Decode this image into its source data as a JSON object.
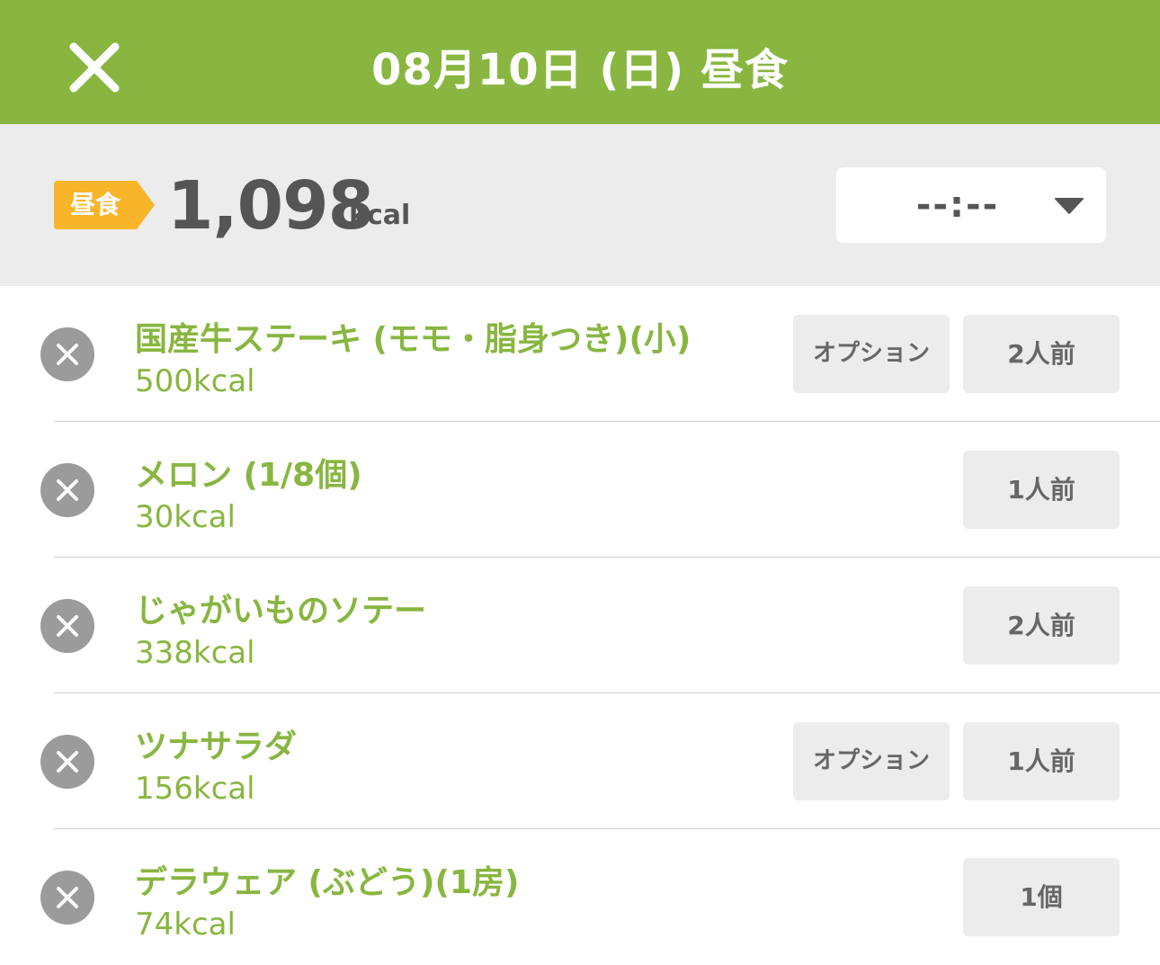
{
  "header": {
    "title": "08月10日 (日) 昼食",
    "close_icon": "close-icon"
  },
  "summary": {
    "meal_label": "昼食",
    "total_kcal": "1,098",
    "kcal_unit": "kcal",
    "time_value": "--:--",
    "time_icon": "chevron-down-icon"
  },
  "colors": {
    "accent": "#88b640",
    "badge": "#f8b52a",
    "summary_bg": "#ececec",
    "remove_icon_bg": "#9b9b9b"
  },
  "food_items": [
    {
      "name": "国産牛ステーキ (モモ・脂身つき)(小)",
      "kcal": "500kcal",
      "option": "オプション",
      "serving": "2人前"
    },
    {
      "name": "メロン (1/8個)",
      "kcal": "30kcal",
      "option": "",
      "serving": "1人前"
    },
    {
      "name": "じゃがいものソテー",
      "kcal": "338kcal",
      "option": "",
      "serving": "2人前"
    },
    {
      "name": "ツナサラダ",
      "kcal": "156kcal",
      "option": "オプション",
      "serving": "1人前"
    },
    {
      "name": "デラウェア (ぶどう)(1房)",
      "kcal": "74kcal",
      "option": "",
      "serving": "1個"
    }
  ]
}
